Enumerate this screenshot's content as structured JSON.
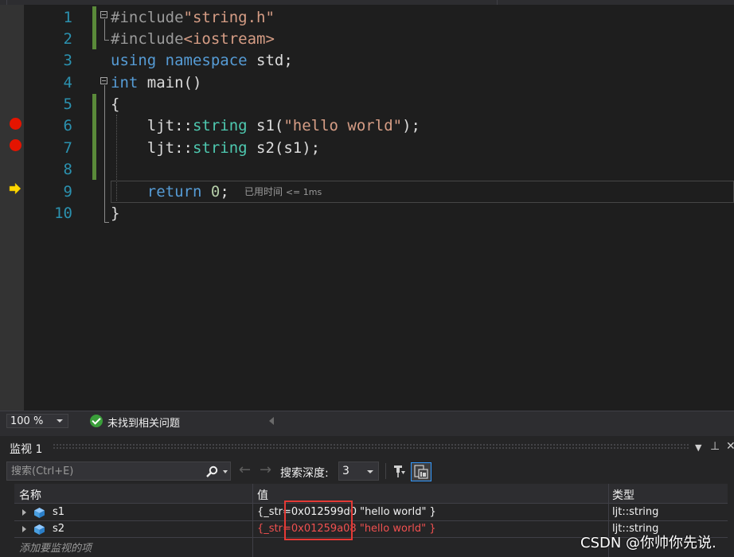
{
  "editor": {
    "line_numbers": [
      "1",
      "2",
      "3",
      "4",
      "5",
      "6",
      "7",
      "8",
      "9",
      "10"
    ],
    "lines": [
      [
        {
          "c": "pp",
          "t": "#include"
        },
        {
          "c": "str",
          "t": "\"string.h\""
        }
      ],
      [
        {
          "c": "pp",
          "t": "#include"
        },
        {
          "c": "str",
          "t": "<iostream>"
        }
      ],
      [
        {
          "c": "kw",
          "t": "using"
        },
        {
          "c": "",
          "t": " "
        },
        {
          "c": "kw",
          "t": "namespace"
        },
        {
          "c": "",
          "t": " std;"
        }
      ],
      [
        {
          "c": "kw",
          "t": "int"
        },
        {
          "c": "",
          "t": " main()"
        }
      ],
      [
        {
          "c": "",
          "t": "{"
        }
      ],
      [
        {
          "c": "",
          "t": "    ljt::"
        },
        {
          "c": "ty",
          "t": "string"
        },
        {
          "c": "",
          "t": " s1("
        },
        {
          "c": "str",
          "t": "\"hello world\""
        },
        {
          "c": "",
          "t": ");"
        }
      ],
      [
        {
          "c": "",
          "t": "    ljt::"
        },
        {
          "c": "ty",
          "t": "string"
        },
        {
          "c": "",
          "t": " s2(s1);"
        }
      ],
      [
        {
          "c": "",
          "t": ""
        }
      ],
      [
        {
          "c": "",
          "t": "    "
        },
        {
          "c": "kw",
          "t": "return"
        },
        {
          "c": "",
          "t": " "
        },
        {
          "c": "num",
          "t": "0"
        },
        {
          "c": "",
          "t": ";"
        }
      ],
      [
        {
          "c": "",
          "t": "}"
        }
      ]
    ],
    "breakpoint_lines": [
      6,
      7
    ],
    "current_line": 9,
    "elapsed_label": "已用时间",
    "elapsed_value": "<= 1ms"
  },
  "status": {
    "zoom": "100 %",
    "issues_text": "未找到相关问题"
  },
  "watch": {
    "title": "监视 1",
    "search_placeholder": "搜索(Ctrl+E)",
    "depth_label": "搜索深度:",
    "depth_value": "3",
    "columns": {
      "name": "名称",
      "value": "值",
      "type": "类型"
    },
    "rows": [
      {
        "name": "s1",
        "value": "{_str=0x012599d0 \"hello world\" }",
        "type": "ljt::string",
        "changed": false
      },
      {
        "name": "s2",
        "value": "{_str=0x01259a08 \"hello world\" }",
        "type": "ljt::string",
        "changed": true
      }
    ],
    "add_hint": "添加要监视的项"
  },
  "watermark": "CSDN @你帅你先说."
}
